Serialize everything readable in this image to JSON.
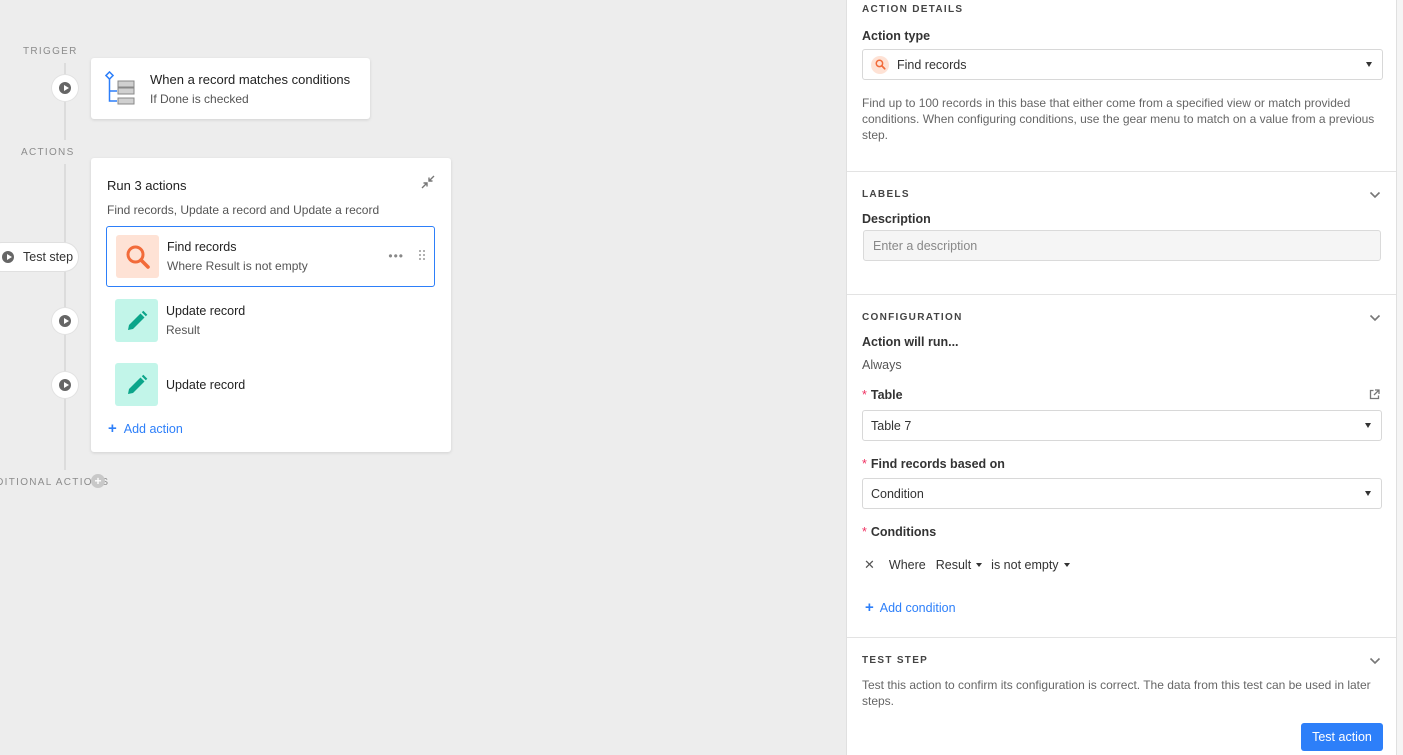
{
  "canvas": {
    "labels": {
      "trigger": "TRIGGER",
      "actions": "ACTIONS",
      "conditional": "CONDITIONAL ACTIONS"
    },
    "trigger": {
      "title": "When a record matches conditions",
      "subtitle": "If Done is checked"
    },
    "test_step_label": "Test step",
    "group": {
      "title": "Run 3 actions",
      "subtitle": "Find records, Update a record and Update a record",
      "items": [
        {
          "title": "Find records",
          "subtitle": "Where Result is not empty",
          "icon": "search-icon"
        },
        {
          "title": "Update record",
          "subtitle": "Result",
          "icon": "pencil-icon"
        },
        {
          "title": "Update record",
          "subtitle": "",
          "icon": "pencil-icon"
        }
      ],
      "add_action": "Add action",
      "more": "•••"
    }
  },
  "panel": {
    "action_details": {
      "header": "ACTION DETAILS",
      "action_type_label": "Action type",
      "action_type_value": "Find records",
      "description": "Find up to 100 records in this base that either come from a specified view or match provided conditions. When configuring conditions, use the gear menu to match on a value from a previous step."
    },
    "labels": {
      "header": "LABELS",
      "description_label": "Description",
      "description_placeholder": "Enter a description"
    },
    "configuration": {
      "header": "CONFIGURATION",
      "run_label": "Action will run...",
      "run_value": "Always",
      "table_label": "Table",
      "table_value": "Table 7",
      "based_on_label": "Find records based on",
      "based_on_value": "Condition",
      "conditions_label": "Conditions",
      "condition": {
        "remove": "✕",
        "where": "Where",
        "field": "Result",
        "operator": "is not empty"
      },
      "add_condition": "Add condition",
      "required_marker": "*"
    },
    "test_step": {
      "header": "TEST STEP",
      "description": "Test this action to confirm its configuration is correct. The data from this test can be used in later steps.",
      "button": "Test action"
    }
  },
  "colors": {
    "accent": "#2d7ff9",
    "find_bg": "#fee2d5",
    "find_fg": "#f26b3a",
    "update_bg": "#c2f5e9",
    "update_fg": "#0ba58a",
    "required": "#ef3061"
  }
}
